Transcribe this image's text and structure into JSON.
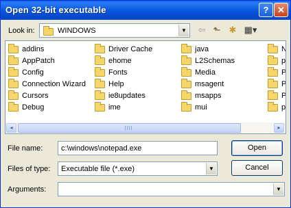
{
  "window": {
    "title": "Open 32-bit executable",
    "help": "?",
    "close": "✕"
  },
  "toolbar": {
    "look_in_label": "Look in:",
    "look_in_value": "WINDOWS",
    "back": "⇦",
    "up": "⬑",
    "new_folder": "✱",
    "view_menu": "▦▾"
  },
  "files": {
    "col1": [
      "addins",
      "AppPatch",
      "Config",
      "Connection Wizard",
      "Cursors",
      "Debug"
    ],
    "col2": [
      "Driver Cache",
      "ehome",
      "Fonts",
      "Help",
      "ie8updates",
      "ime"
    ],
    "col3": [
      "java",
      "L2Schemas",
      "Media",
      "msagent",
      "msapps",
      "mui"
    ],
    "col4": [
      "Ne",
      "pc",
      "Pe",
      "Pr",
      "Pr",
      "ps"
    ]
  },
  "scroll": {
    "left": "◂",
    "right": "▸"
  },
  "form": {
    "file_name_label": "File name:",
    "file_name_value": "c:\\windows\\notepad.exe",
    "files_of_type_label": "Files of type:",
    "files_of_type_value": "Executable file (*.exe)",
    "arguments_label": "Arguments:",
    "arguments_value": "",
    "open_label": "Open",
    "cancel_label": "Cancel",
    "dropdown_arrow": "▼"
  }
}
